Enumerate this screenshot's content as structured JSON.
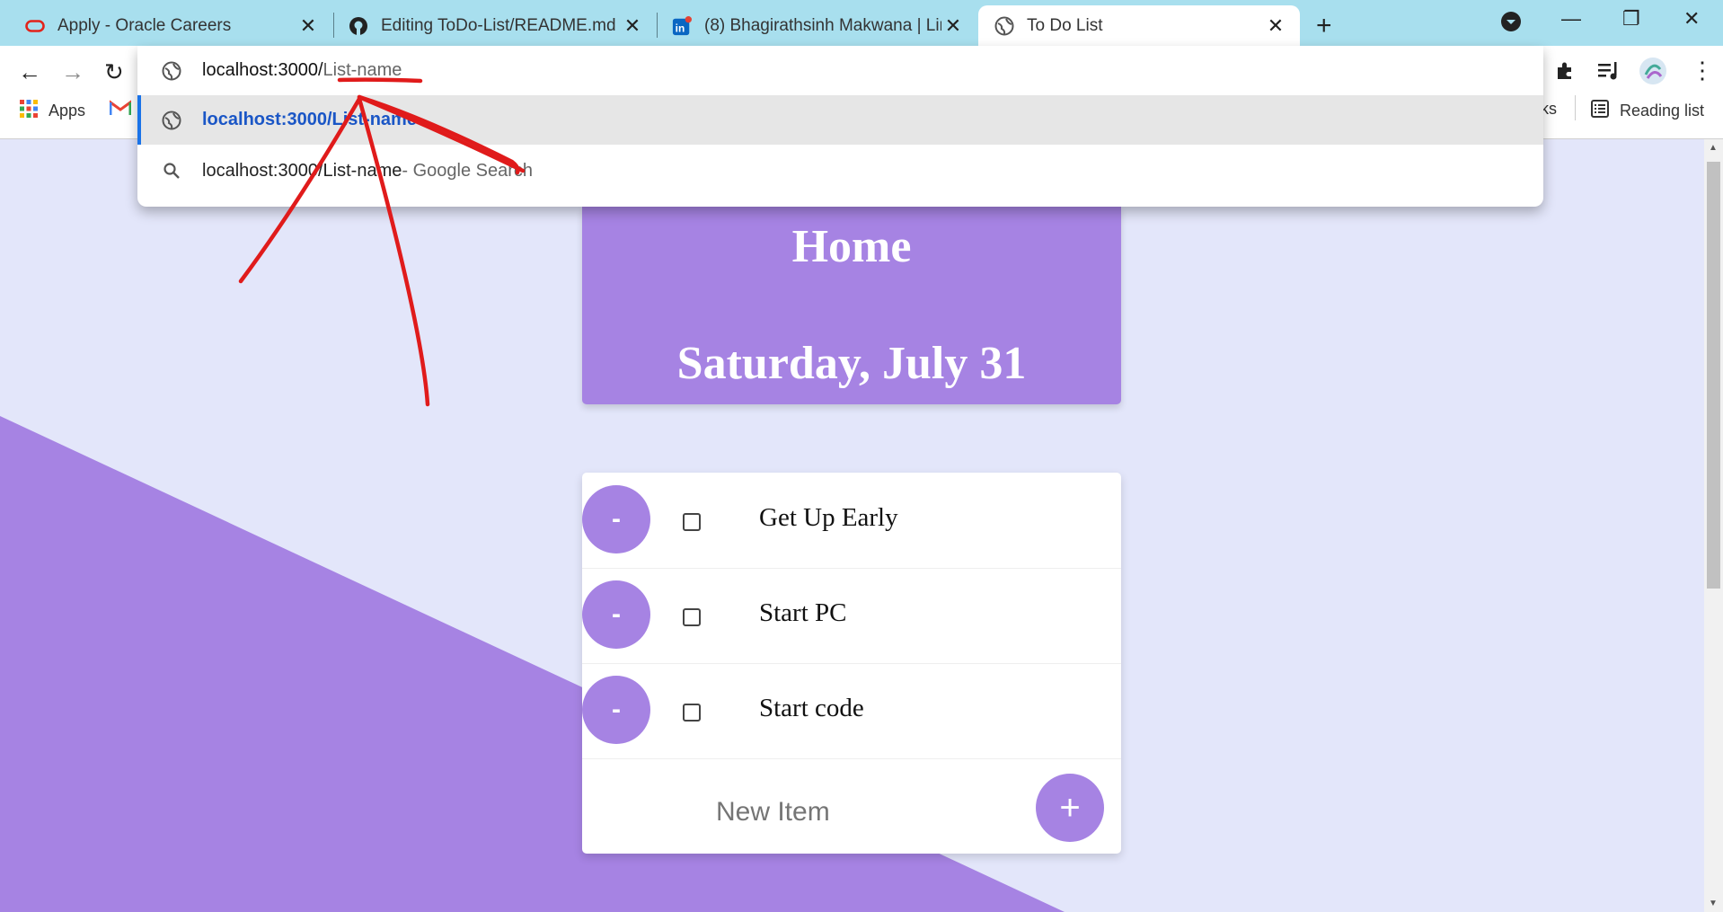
{
  "browser": {
    "tabs": [
      {
        "title": "Apply - Oracle Careers",
        "icon": "oracle-icon"
      },
      {
        "title": "Editing ToDo-List/README.md at",
        "icon": "github-icon"
      },
      {
        "title": "(8) Bhagirathsinh Makwana | Link",
        "icon": "linkedin-icon"
      },
      {
        "title": "To Do List",
        "icon": "globe-icon",
        "active": true
      }
    ],
    "bookmarks": {
      "apps": "Apps",
      "partial": "ks",
      "reading_list": "Reading list"
    }
  },
  "omnibox": {
    "host": "localhost:3000/",
    "path": "List-name",
    "suggestion_1": "localhost:3000/List-name",
    "suggestion_2_query": "localhost:3000/List-name",
    "suggestion_2_suffix": " - Google Search"
  },
  "page": {
    "title": "Home",
    "date": "Saturday, July 31",
    "items": [
      {
        "text": "Get Up Early",
        "delete_label": "-"
      },
      {
        "text": "Start PC",
        "delete_label": "-"
      },
      {
        "text": "Start code",
        "delete_label": "-"
      }
    ],
    "new_item_placeholder": "New Item",
    "add_label": "+"
  },
  "colors": {
    "accent": "#a683e3",
    "page_bg": "#e3e6fa",
    "tabstrip": "#a8dfee",
    "annotation": "#e01b1b"
  }
}
